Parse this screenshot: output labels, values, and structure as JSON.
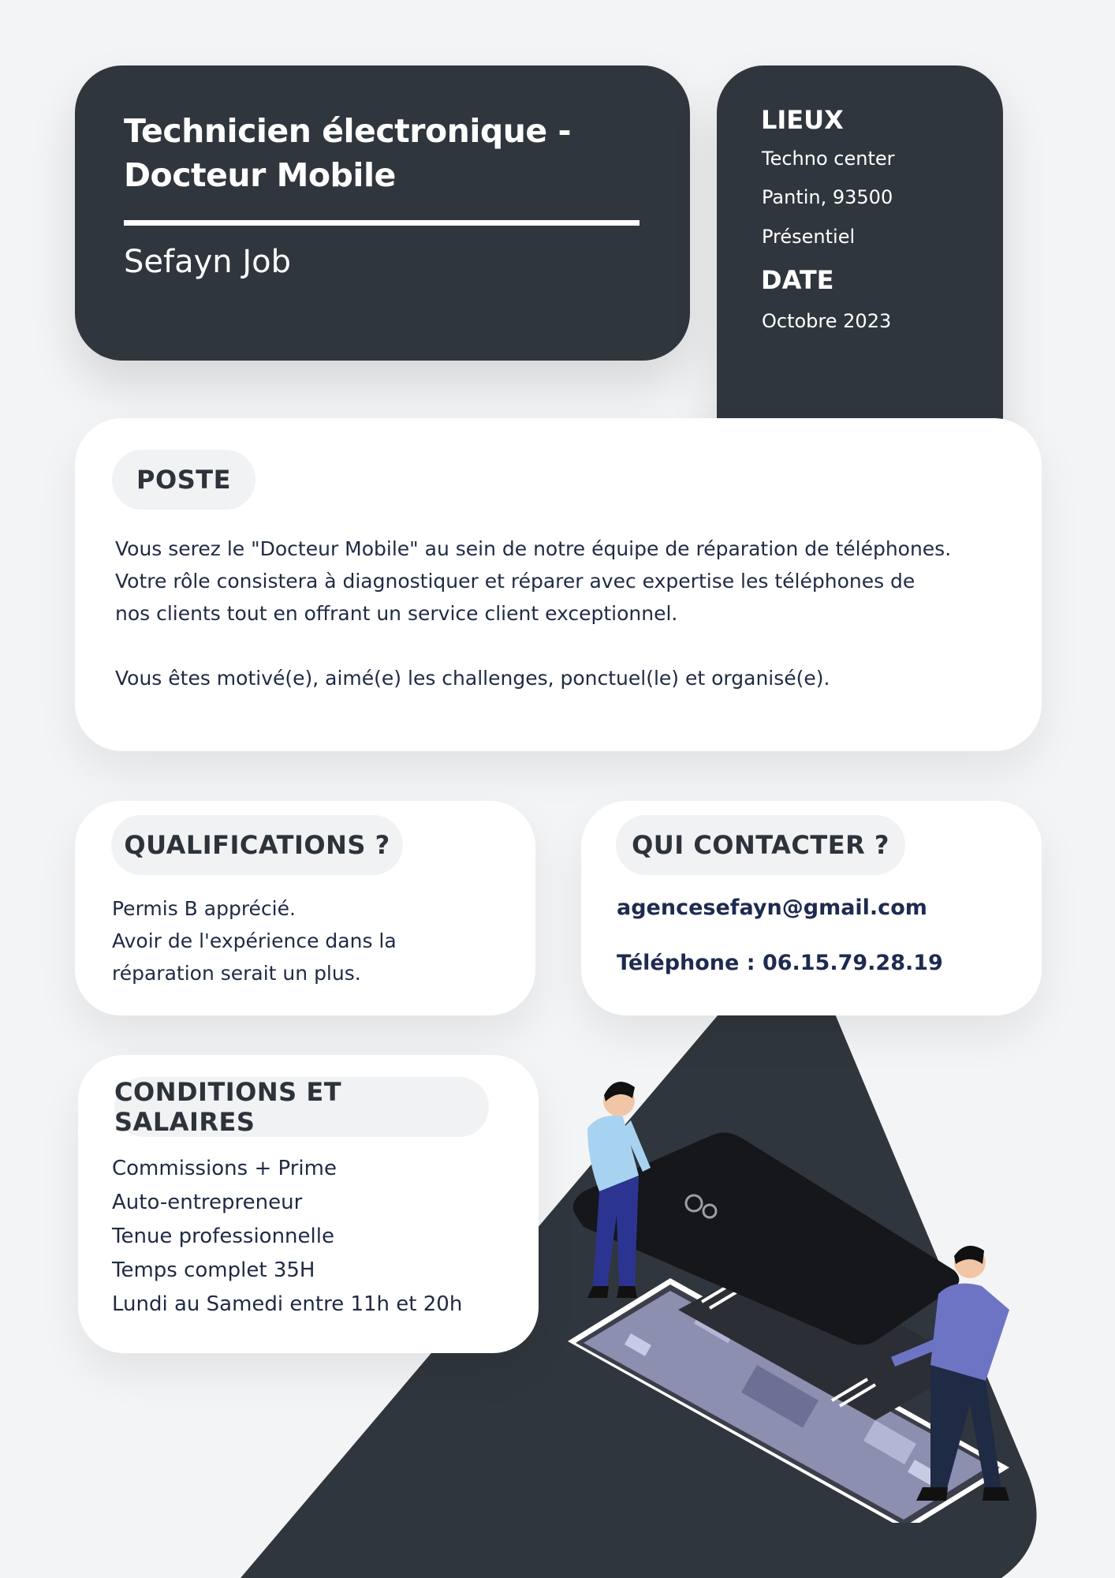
{
  "header": {
    "title_line1": "Technicien électronique -",
    "title_line2": "Docteur Mobile",
    "company": "Sefayn Job"
  },
  "info": {
    "lieux_heading": "LIEUX",
    "lieux_lines": [
      "Techno center",
      "Pantin, 93500",
      "Présentiel"
    ],
    "date_heading": "DATE",
    "date_value": "Octobre 2023"
  },
  "poste": {
    "heading": "POSTE",
    "lines": [
      "Vous serez le \"Docteur Mobile\" au sein de notre équipe de réparation de téléphones.",
      "Votre rôle consistera à diagnostiquer et réparer avec expertise les téléphones de",
      "nos clients tout en offrant un service client exceptionnel.",
      "Vous êtes motivé(e), aimé(e) les challenges, ponctuel(le) et organisé(e)."
    ]
  },
  "qualifications": {
    "heading": "QUALIFICATIONS ?",
    "lines": [
      "Permis B apprécié.",
      "Avoir de l'expérience dans la",
      "réparation serait un plus."
    ]
  },
  "contact": {
    "heading": "QUI CONTACTER ?",
    "email": "agencesefayn@gmail.com",
    "phone": "Téléphone : 06.15.79.28.19"
  },
  "conditions": {
    "heading": "CONDITIONS ET SALAIRES",
    "lines": [
      "Commissions + Prime",
      "Auto-entrepreneur",
      "Tenue professionnelle",
      "Temps complet 35H",
      "Lundi au Samedi entre 11h et 20h"
    ]
  },
  "colors": {
    "dark": "#30363d",
    "background": "#f3f4f6",
    "text": "#1f2a44"
  },
  "illustration": {
    "icon": "phone-repair-illustration"
  }
}
